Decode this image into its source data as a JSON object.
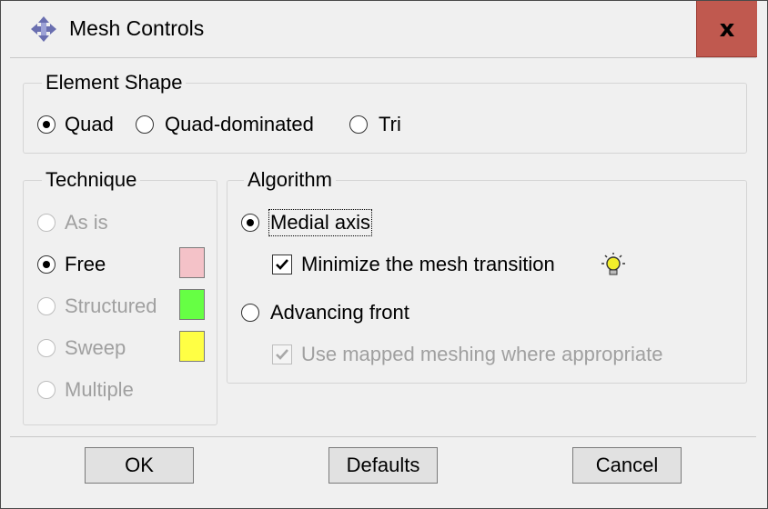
{
  "window": {
    "title": "Mesh Controls",
    "close_label": "x",
    "title_icon": "mesh-controls-app-icon"
  },
  "element_shape": {
    "title": "Element Shape",
    "options": [
      {
        "label": "Quad",
        "selected": true
      },
      {
        "label": "Quad-dominated",
        "selected": false
      },
      {
        "label": "Tri",
        "selected": false
      }
    ]
  },
  "technique": {
    "title": "Technique",
    "options": [
      {
        "label": "As is",
        "selected": false,
        "enabled": false
      },
      {
        "label": "Free",
        "selected": true,
        "enabled": true,
        "swatch": "#f4c2c8"
      },
      {
        "label": "Structured",
        "selected": false,
        "enabled": false,
        "swatch": "#66ff44"
      },
      {
        "label": "Sweep",
        "selected": false,
        "enabled": false,
        "swatch": "#ffff44"
      },
      {
        "label": "Multiple",
        "selected": false,
        "enabled": false
      }
    ]
  },
  "algorithm": {
    "title": "Algorithm",
    "medial_axis": {
      "label": "Medial axis",
      "selected": true
    },
    "minimize_transition": {
      "label": "Minimize the mesh transition",
      "checked": true,
      "hint_icon": "lightbulb-icon"
    },
    "advancing_front": {
      "label": "Advancing front",
      "selected": false
    },
    "mapped_meshing": {
      "label": "Use mapped meshing where appropriate",
      "checked": true,
      "enabled": false
    }
  },
  "buttons": {
    "ok": "OK",
    "defaults": "Defaults",
    "cancel": "Cancel"
  },
  "colors": {
    "close_bg": "#c0594f",
    "free_swatch": "#f4c2c8",
    "structured_swatch": "#66ff44",
    "sweep_swatch": "#ffff44"
  }
}
